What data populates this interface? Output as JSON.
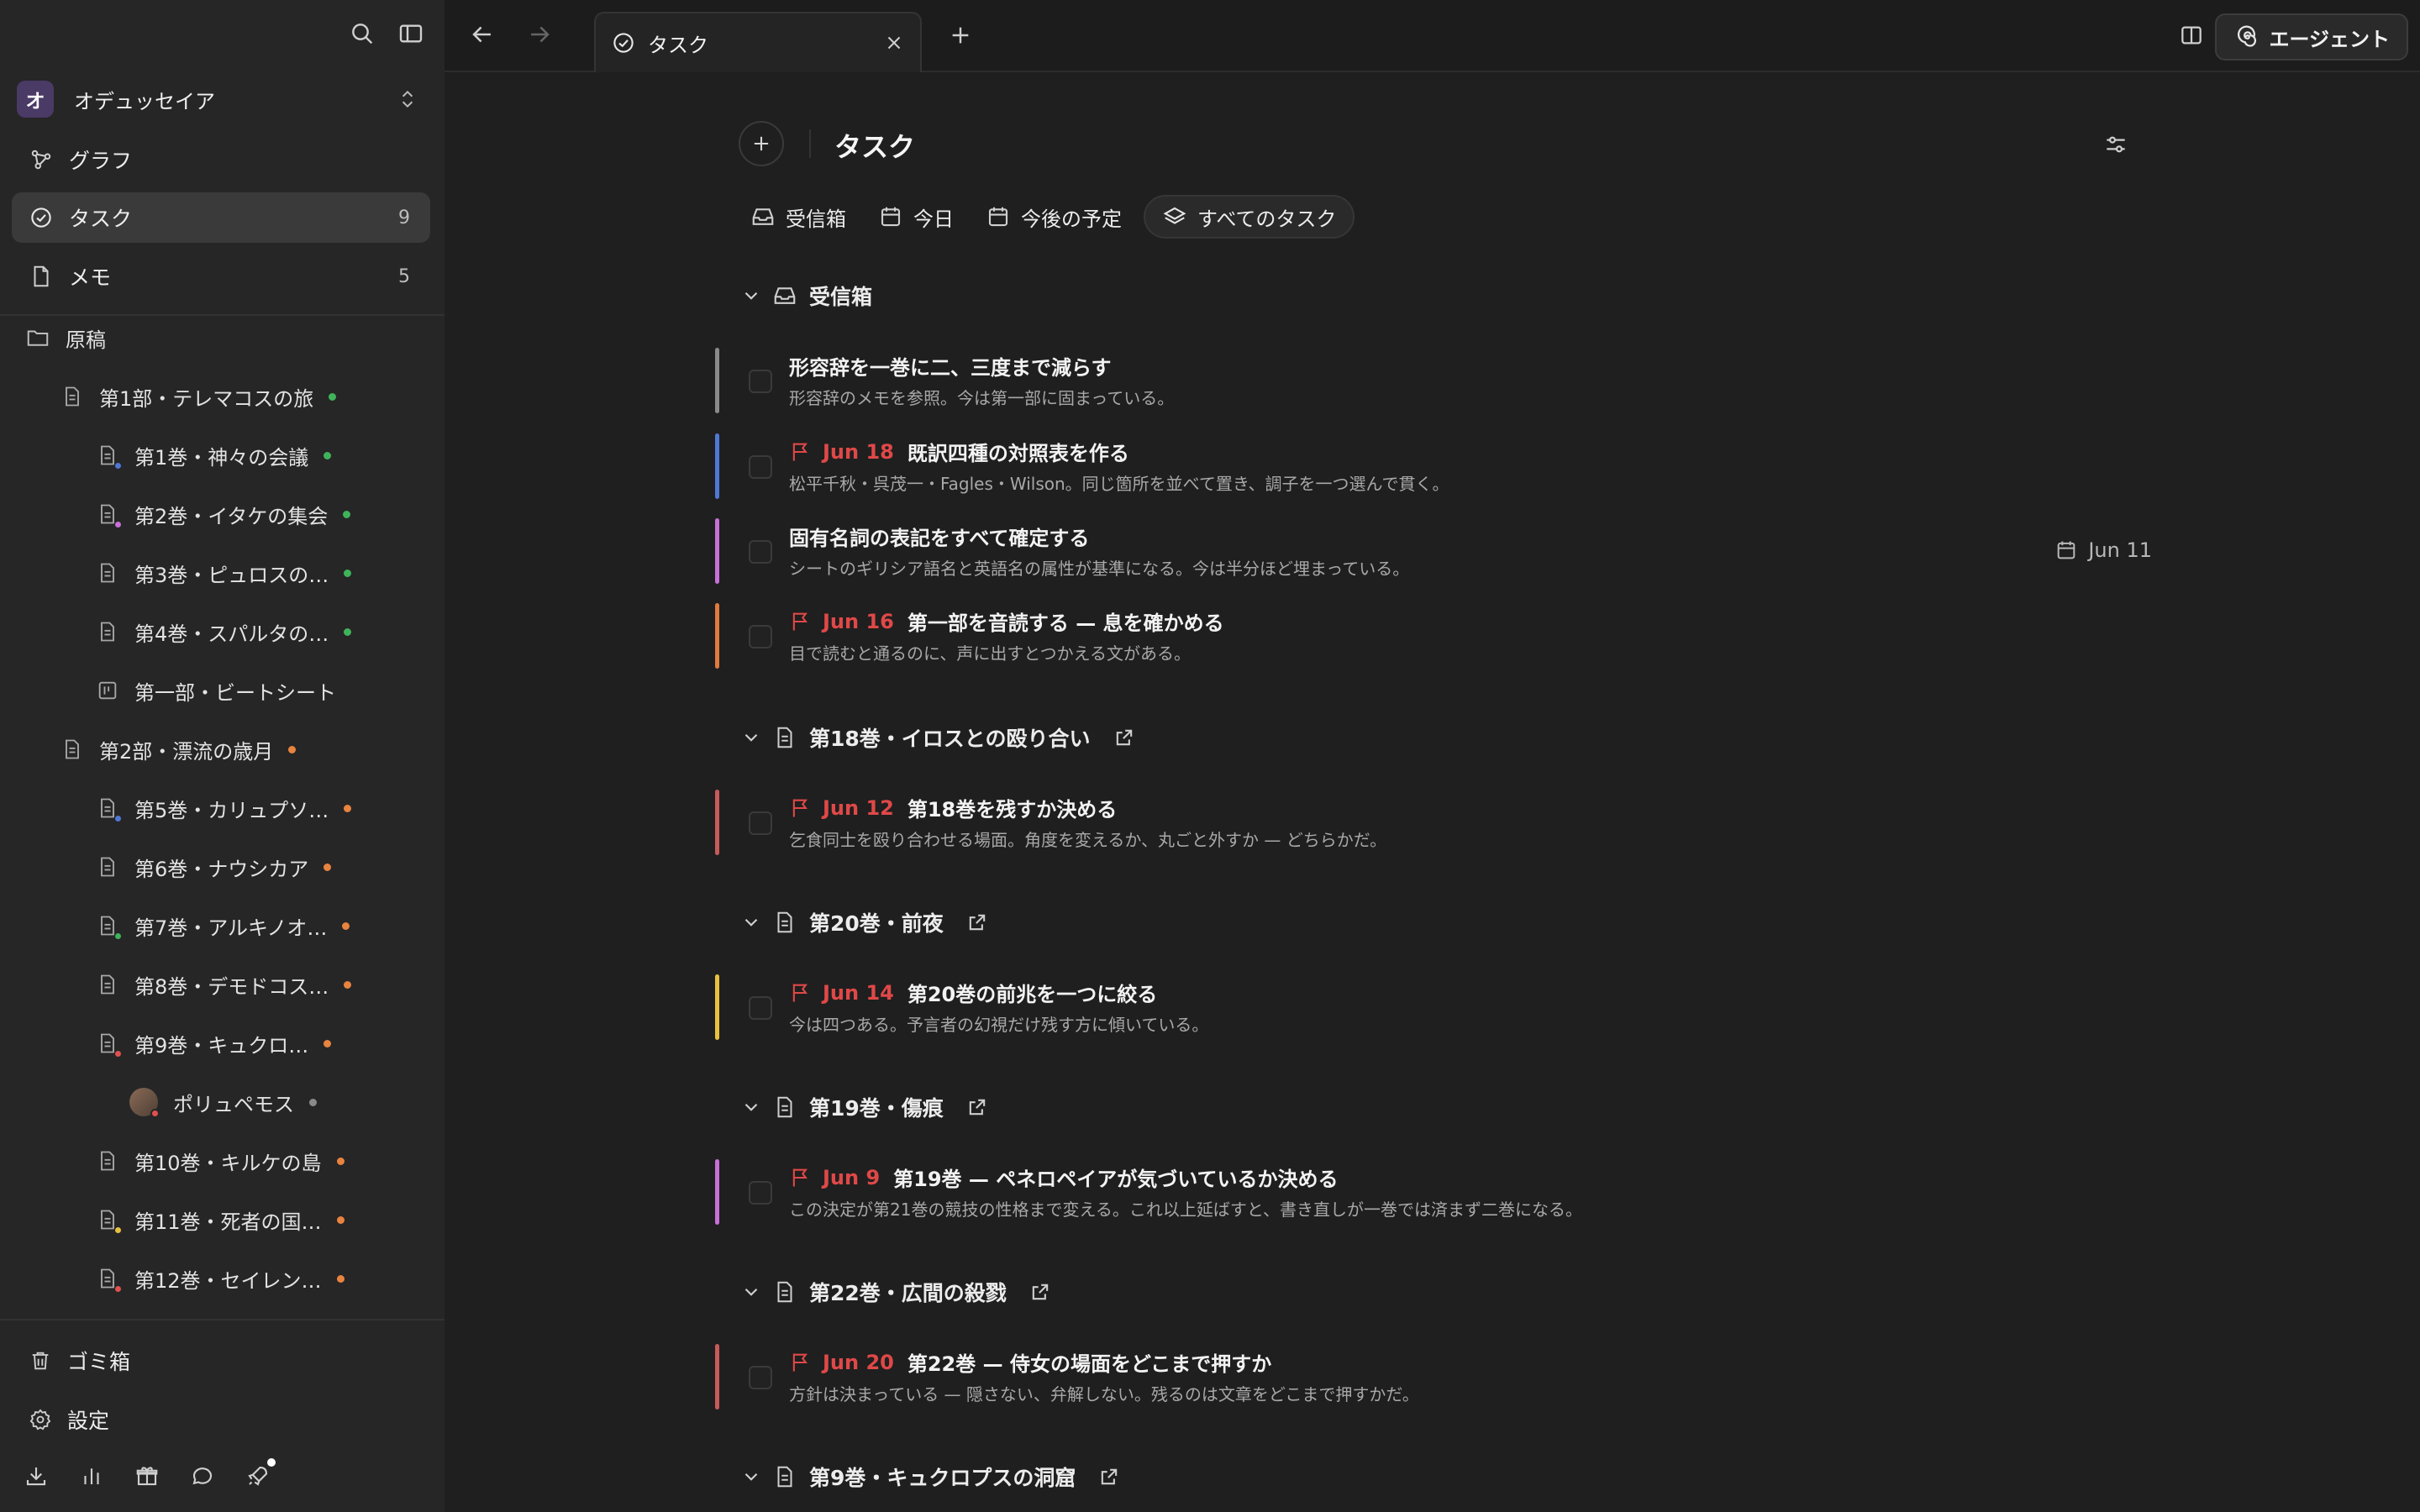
{
  "sidebar": {
    "workspace": {
      "initial": "オ",
      "name": "オデュッセイア"
    },
    "nav": [
      {
        "label": "グラフ",
        "count": ""
      },
      {
        "label": "タスク",
        "count": "9"
      },
      {
        "label": "メモ",
        "count": "5"
      }
    ],
    "tree": [
      {
        "label": "原稿"
      },
      {
        "label": "第1部・テレマコスの旅"
      },
      {
        "label": "第1巻・神々の会議"
      },
      {
        "label": "第2巻・イタケの集会"
      },
      {
        "label": "第3巻・ピュロスの…"
      },
      {
        "label": "第4巻・スパルタの…"
      },
      {
        "label": "第一部・ビートシート"
      },
      {
        "label": "第2部・漂流の歳月"
      },
      {
        "label": "第5巻・カリュプソ…"
      },
      {
        "label": "第6巻・ナウシカア"
      },
      {
        "label": "第7巻・アルキノオ…"
      },
      {
        "label": "第8巻・デモドコス…"
      },
      {
        "label": "第9巻・キュクロ…"
      },
      {
        "label": "ポリュペモス"
      },
      {
        "label": "第10巻・キルケの島"
      },
      {
        "label": "第11巻・死者の国…"
      },
      {
        "label": "第12巻・セイレン…"
      }
    ],
    "bottom": {
      "trash": "ゴミ箱",
      "settings": "設定"
    }
  },
  "topbar": {
    "tab_label": "タスク",
    "agent_label": "エージェント"
  },
  "main": {
    "title": "タスク",
    "view_tabs": [
      {
        "label": "受信箱"
      },
      {
        "label": "今日"
      },
      {
        "label": "今後の予定"
      },
      {
        "label": "すべてのタスク"
      }
    ],
    "groups": [
      {
        "label": "受信箱"
      },
      {
        "label": "第18巻・イロスとの殴り合い"
      },
      {
        "label": "第20巻・前夜"
      },
      {
        "label": "第19巻・傷痕"
      },
      {
        "label": "第22巻・広間の殺戮"
      },
      {
        "label": "第9巻・キュクロプスの洞窟"
      }
    ],
    "tasks": [
      {
        "title": "形容辞を一巻に二、三度まで減らす",
        "note": "形容辞のメモを参照。今は第一部に固まっている。",
        "due": "",
        "scheduled": "",
        "color": "#8a8a8a"
      },
      {
        "title": "既訳四種の対照表を作る",
        "note": "松平千秋・呉茂一・Fagles・Wilson。同じ箇所を並べて置き、調子を一つ選んで貫く。",
        "due": "Jun 18",
        "scheduled": "",
        "color": "#4f78d6"
      },
      {
        "title": "固有名詞の表記をすべて確定する",
        "note": "シートのギリシア語名と英語名の属性が基準になる。今は半分ほど埋まっている。",
        "due": "",
        "scheduled": "Jun 11",
        "color": "#c86fd8"
      },
      {
        "title": "第一部を音読する — 息を確かめる",
        "note": "目で読むと通るのに、声に出すとつかえる文がある。",
        "due": "Jun 16",
        "scheduled": "",
        "color": "#e07a40"
      },
      {
        "title": "第18巻を残すか決める",
        "note": "乞食同士を殴り合わせる場面。角度を変えるか、丸ごと外すか — どちらかだ。",
        "due": "Jun 12",
        "scheduled": "",
        "color": "#c85a5a"
      },
      {
        "title": "第20巻の前兆を一つに絞る",
        "note": "今は四つある。予言者の幻視だけ残す方に傾いている。",
        "due": "Jun 14",
        "scheduled": "",
        "color": "#e8c040"
      },
      {
        "title": "第19巻 — ペネロペイアが気づいているか決める",
        "note": "この決定が第21巻の競技の性格まで変える。これ以上延ばすと、書き直しが一巻では済まず二巻になる。",
        "due": "Jun 9",
        "scheduled": "",
        "color": "#c86fd8"
      },
      {
        "title": "第22巻 — 侍女の場面をどこまで押すか",
        "note": "方針は決まっている — 隠さない、弁解しない。残るのは文章をどこまで押すかだ。",
        "due": "Jun 20",
        "scheduled": "",
        "color": "#c85a5a"
      }
    ]
  }
}
